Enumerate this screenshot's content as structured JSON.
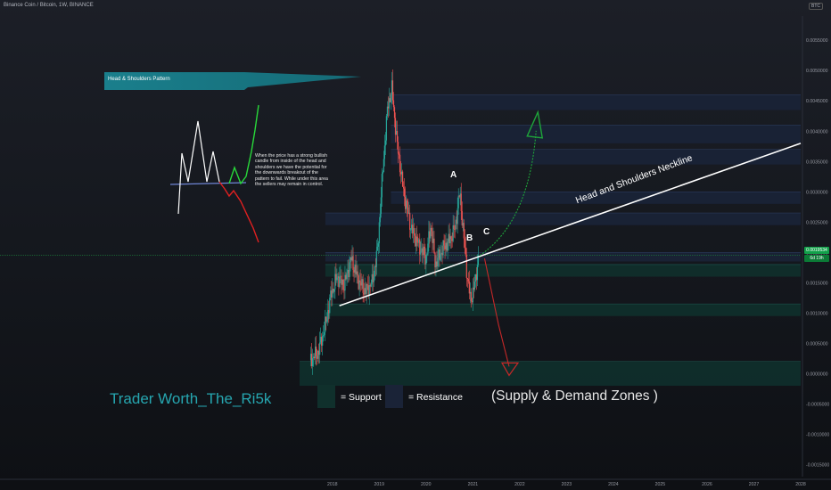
{
  "header": {
    "symbol": "Binance Coin / Bitcoin, 1W, BINANCE",
    "currency": "BTC"
  },
  "colors": {
    "background": "#131722",
    "up": "#26a69a",
    "down": "#ef5350",
    "neckline": "#ffffff",
    "callout": "#1a7f8c",
    "support_zone": "#10302c",
    "resistance_zone": "#1a2337",
    "arrow_up": "#1ea53a",
    "arrow_down": "#c62828",
    "brand": "#26a6b0"
  },
  "callout": {
    "label": "Head & Shoulders Pattern"
  },
  "description": "When the price has a strong bullish candle from inside of the head and shoulders we have the potential for the downwards breakout of the pattern to fail. While under this area the sellers may remain in control.",
  "points": {
    "a": "A",
    "b": "B",
    "c": "C"
  },
  "neckline_label": "Head and Shoulders Neckline",
  "legend": {
    "brand": "Trader Worth_The_Ri5k",
    "support": "= Support",
    "resistance": "= Resistance",
    "zones_title": "(Supply & Demand Zones )"
  },
  "price_tags": {
    "current": "0.0019534",
    "countdown": "6d 19h"
  },
  "chart_data": {
    "type": "candlestick",
    "title": "Binance Coin / Bitcoin, 1W, BINANCE",
    "y_ticks": [
      "0.0055000",
      "0.0050000",
      "0.0045000",
      "0.0040000",
      "0.0035000",
      "0.0030000",
      "0.0025000",
      "0.0020000",
      "0.0015000",
      "0.0010000",
      "0.0005000",
      "0.0000000",
      "-0.0005000",
      "-0.0010000",
      "-0.0015000"
    ],
    "x_ticks": [
      "2018",
      "2019",
      "2020",
      "2021",
      "2022",
      "2023",
      "2024",
      "2025",
      "2026",
      "2027",
      "2028"
    ],
    "ylim": [
      -0.0017,
      0.0059
    ],
    "xlim": [
      2017.3,
      2028.0
    ],
    "price_path": [
      [
        2017.52,
        0.00022
      ],
      [
        2017.7,
        0.00035
      ],
      [
        2017.85,
        0.0008
      ],
      [
        2017.97,
        0.0013
      ],
      [
        2018.1,
        0.0016
      ],
      [
        2018.25,
        0.00145
      ],
      [
        2018.4,
        0.0019
      ],
      [
        2018.55,
        0.00155
      ],
      [
        2018.7,
        0.00135
      ],
      [
        2018.85,
        0.0015
      ],
      [
        2018.96,
        0.002
      ],
      [
        2019.08,
        0.0034
      ],
      [
        2019.18,
        0.0044
      ],
      [
        2019.27,
        0.0047
      ],
      [
        2019.38,
        0.0038
      ],
      [
        2019.52,
        0.003
      ],
      [
        2019.68,
        0.0024
      ],
      [
        2019.85,
        0.0021
      ],
      [
        2020.0,
        0.0019
      ],
      [
        2020.1,
        0.00245
      ],
      [
        2020.2,
        0.0018
      ],
      [
        2020.35,
        0.00205
      ],
      [
        2020.5,
        0.0022
      ],
      [
        2020.62,
        0.0024
      ],
      [
        2020.72,
        0.003
      ],
      [
        2020.8,
        0.0023
      ],
      [
        2020.88,
        0.0016
      ],
      [
        2020.95,
        0.0012
      ],
      [
        2021.05,
        0.0015
      ],
      [
        2021.12,
        0.00195
      ]
    ],
    "current_price": 0.0019534,
    "neckline": [
      [
        2018.15,
        0.00112
      ],
      [
        2028.0,
        0.0038
      ]
    ],
    "supply_demand_zones": [
      {
        "kind": "resistance",
        "low": 0.00435,
        "high": 0.0046,
        "x_start": 2019.25
      },
      {
        "kind": "resistance",
        "low": 0.0038,
        "high": 0.0041,
        "x_start": 2019.25
      },
      {
        "kind": "resistance",
        "low": 0.00345,
        "high": 0.0037,
        "x_start": 2019.25
      },
      {
        "kind": "resistance",
        "low": 0.0028,
        "high": 0.003,
        "x_start": 2019.25
      },
      {
        "kind": "resistance",
        "low": 0.00245,
        "high": 0.00265,
        "x_start": 2017.85
      },
      {
        "kind": "resistance",
        "low": 0.00185,
        "high": 0.002,
        "x_start": 2017.85
      },
      {
        "kind": "support",
        "low": 0.0016,
        "high": 0.0018,
        "x_start": 2017.85
      },
      {
        "kind": "support",
        "low": 0.00095,
        "high": 0.00115,
        "x_start": 2017.85
      },
      {
        "kind": "support",
        "low": -0.0002,
        "high": 0.0002,
        "x_start": 2017.3
      }
    ],
    "scenario_up": [
      [
        2021.15,
        0.00195
      ],
      [
        2021.7,
        0.0027
      ],
      [
        2022.1,
        0.0036
      ],
      [
        2022.35,
        0.0043
      ]
    ],
    "scenario_down": [
      [
        2021.25,
        0.0019
      ],
      [
        2021.55,
        0.0008
      ],
      [
        2021.85,
        0.0
      ]
    ],
    "legend_placement": "bottom"
  }
}
